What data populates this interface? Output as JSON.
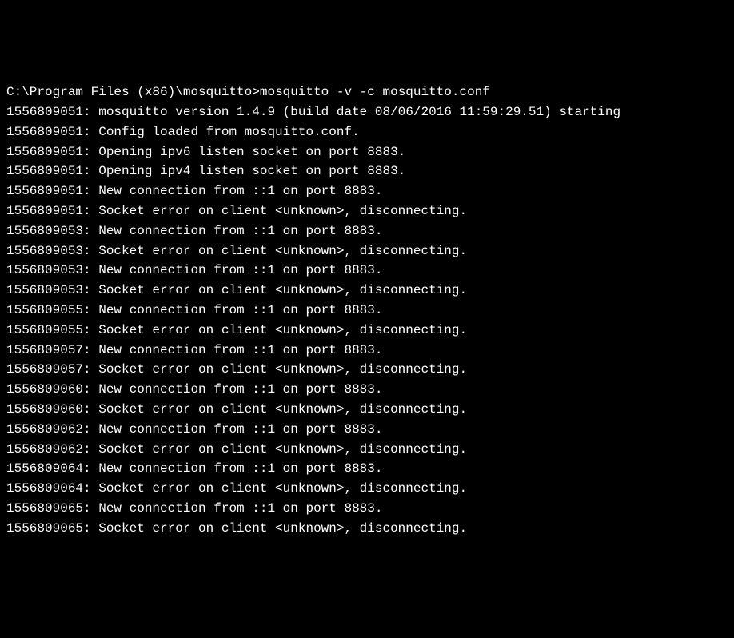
{
  "terminal": {
    "prompt_path": "C:\\Program Files (x86)\\mosquitto>",
    "command": "mosquitto -v -c mosquitto.conf",
    "log_lines": [
      {
        "timestamp": "1556809051",
        "message": "mosquitto version 1.4.9 (build date 08/06/2016 11:59:29.51) starting"
      },
      {
        "timestamp": "1556809051",
        "message": "Config loaded from mosquitto.conf."
      },
      {
        "timestamp": "1556809051",
        "message": "Opening ipv6 listen socket on port 8883."
      },
      {
        "timestamp": "1556809051",
        "message": "Opening ipv4 listen socket on port 8883."
      },
      {
        "timestamp": "1556809051",
        "message": "New connection from ::1 on port 8883."
      },
      {
        "timestamp": "1556809051",
        "message": "Socket error on client <unknown>, disconnecting."
      },
      {
        "timestamp": "1556809053",
        "message": "New connection from ::1 on port 8883."
      },
      {
        "timestamp": "1556809053",
        "message": "Socket error on client <unknown>, disconnecting."
      },
      {
        "timestamp": "1556809053",
        "message": "New connection from ::1 on port 8883."
      },
      {
        "timestamp": "1556809053",
        "message": "Socket error on client <unknown>, disconnecting."
      },
      {
        "timestamp": "1556809055",
        "message": "New connection from ::1 on port 8883."
      },
      {
        "timestamp": "1556809055",
        "message": "Socket error on client <unknown>, disconnecting."
      },
      {
        "timestamp": "1556809057",
        "message": "New connection from ::1 on port 8883."
      },
      {
        "timestamp": "1556809057",
        "message": "Socket error on client <unknown>, disconnecting."
      },
      {
        "timestamp": "1556809060",
        "message": "New connection from ::1 on port 8883."
      },
      {
        "timestamp": "1556809060",
        "message": "Socket error on client <unknown>, disconnecting."
      },
      {
        "timestamp": "1556809062",
        "message": "New connection from ::1 on port 8883."
      },
      {
        "timestamp": "1556809062",
        "message": "Socket error on client <unknown>, disconnecting."
      },
      {
        "timestamp": "1556809064",
        "message": "New connection from ::1 on port 8883."
      },
      {
        "timestamp": "1556809064",
        "message": "Socket error on client <unknown>, disconnecting."
      },
      {
        "timestamp": "1556809065",
        "message": "New connection from ::1 on port 8883."
      },
      {
        "timestamp": "1556809065",
        "message": "Socket error on client <unknown>, disconnecting."
      }
    ]
  }
}
